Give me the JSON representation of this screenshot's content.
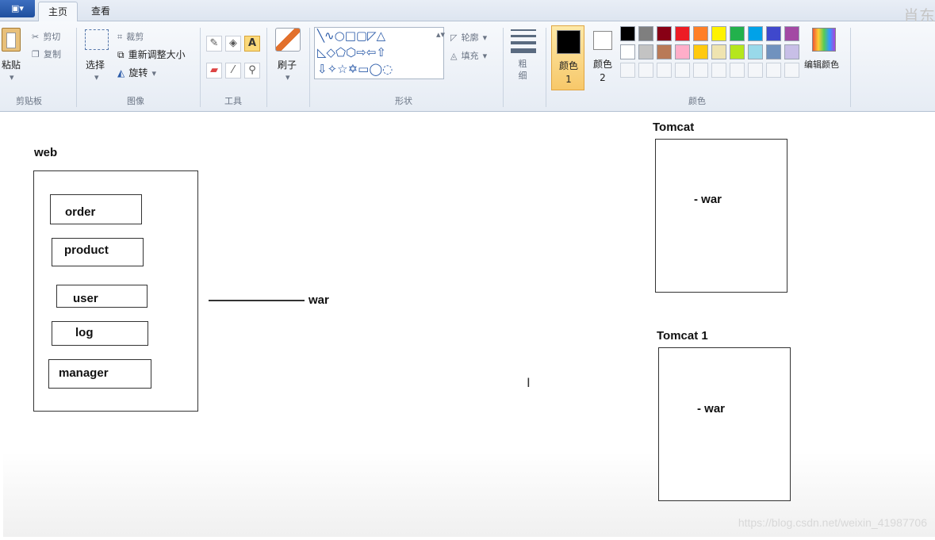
{
  "tabs": {
    "file_label": "▣▾",
    "home": "主页",
    "view": "查看",
    "corner": "肖东"
  },
  "clipboard": {
    "paste": "粘贴",
    "cut": "剪切",
    "copy": "复制",
    "group": "剪贴板"
  },
  "image": {
    "select": "选择",
    "crop": "裁剪",
    "resize": "重新调整大小",
    "rotate": "旋转",
    "group": "图像"
  },
  "tools": {
    "group": "工具",
    "text_glyph": "A"
  },
  "brush": {
    "label": "刷子"
  },
  "shapes": {
    "outline": "轮廓",
    "fill": "填充",
    "group": "形状"
  },
  "size": {
    "label": "粗细"
  },
  "colors": {
    "color1_label": "颜色 1",
    "color2_label": "颜色 2",
    "edit": "编辑颜色",
    "group": "颜色",
    "row1": [
      "#000000",
      "#7f7f7f",
      "#880015",
      "#ed1c24",
      "#ff7f27",
      "#fff200",
      "#22b14c",
      "#00a2e8",
      "#3f48cc",
      "#a349a4"
    ],
    "row2": [
      "#ffffff",
      "#c3c3c3",
      "#b97a57",
      "#ffaec9",
      "#ffc90e",
      "#efe4b0",
      "#b5e61d",
      "#99d9ea",
      "#7092be",
      "#c8bfe7"
    ]
  },
  "canvas": {
    "web": "web",
    "items": [
      "order",
      "product",
      "user",
      "log",
      "manager"
    ],
    "war": "war",
    "tomcat": "Tomcat",
    "tomcat1": "Tomcat 1",
    "war_item": "- war",
    "watermark": "https://blog.csdn.net/weixin_41987706"
  }
}
